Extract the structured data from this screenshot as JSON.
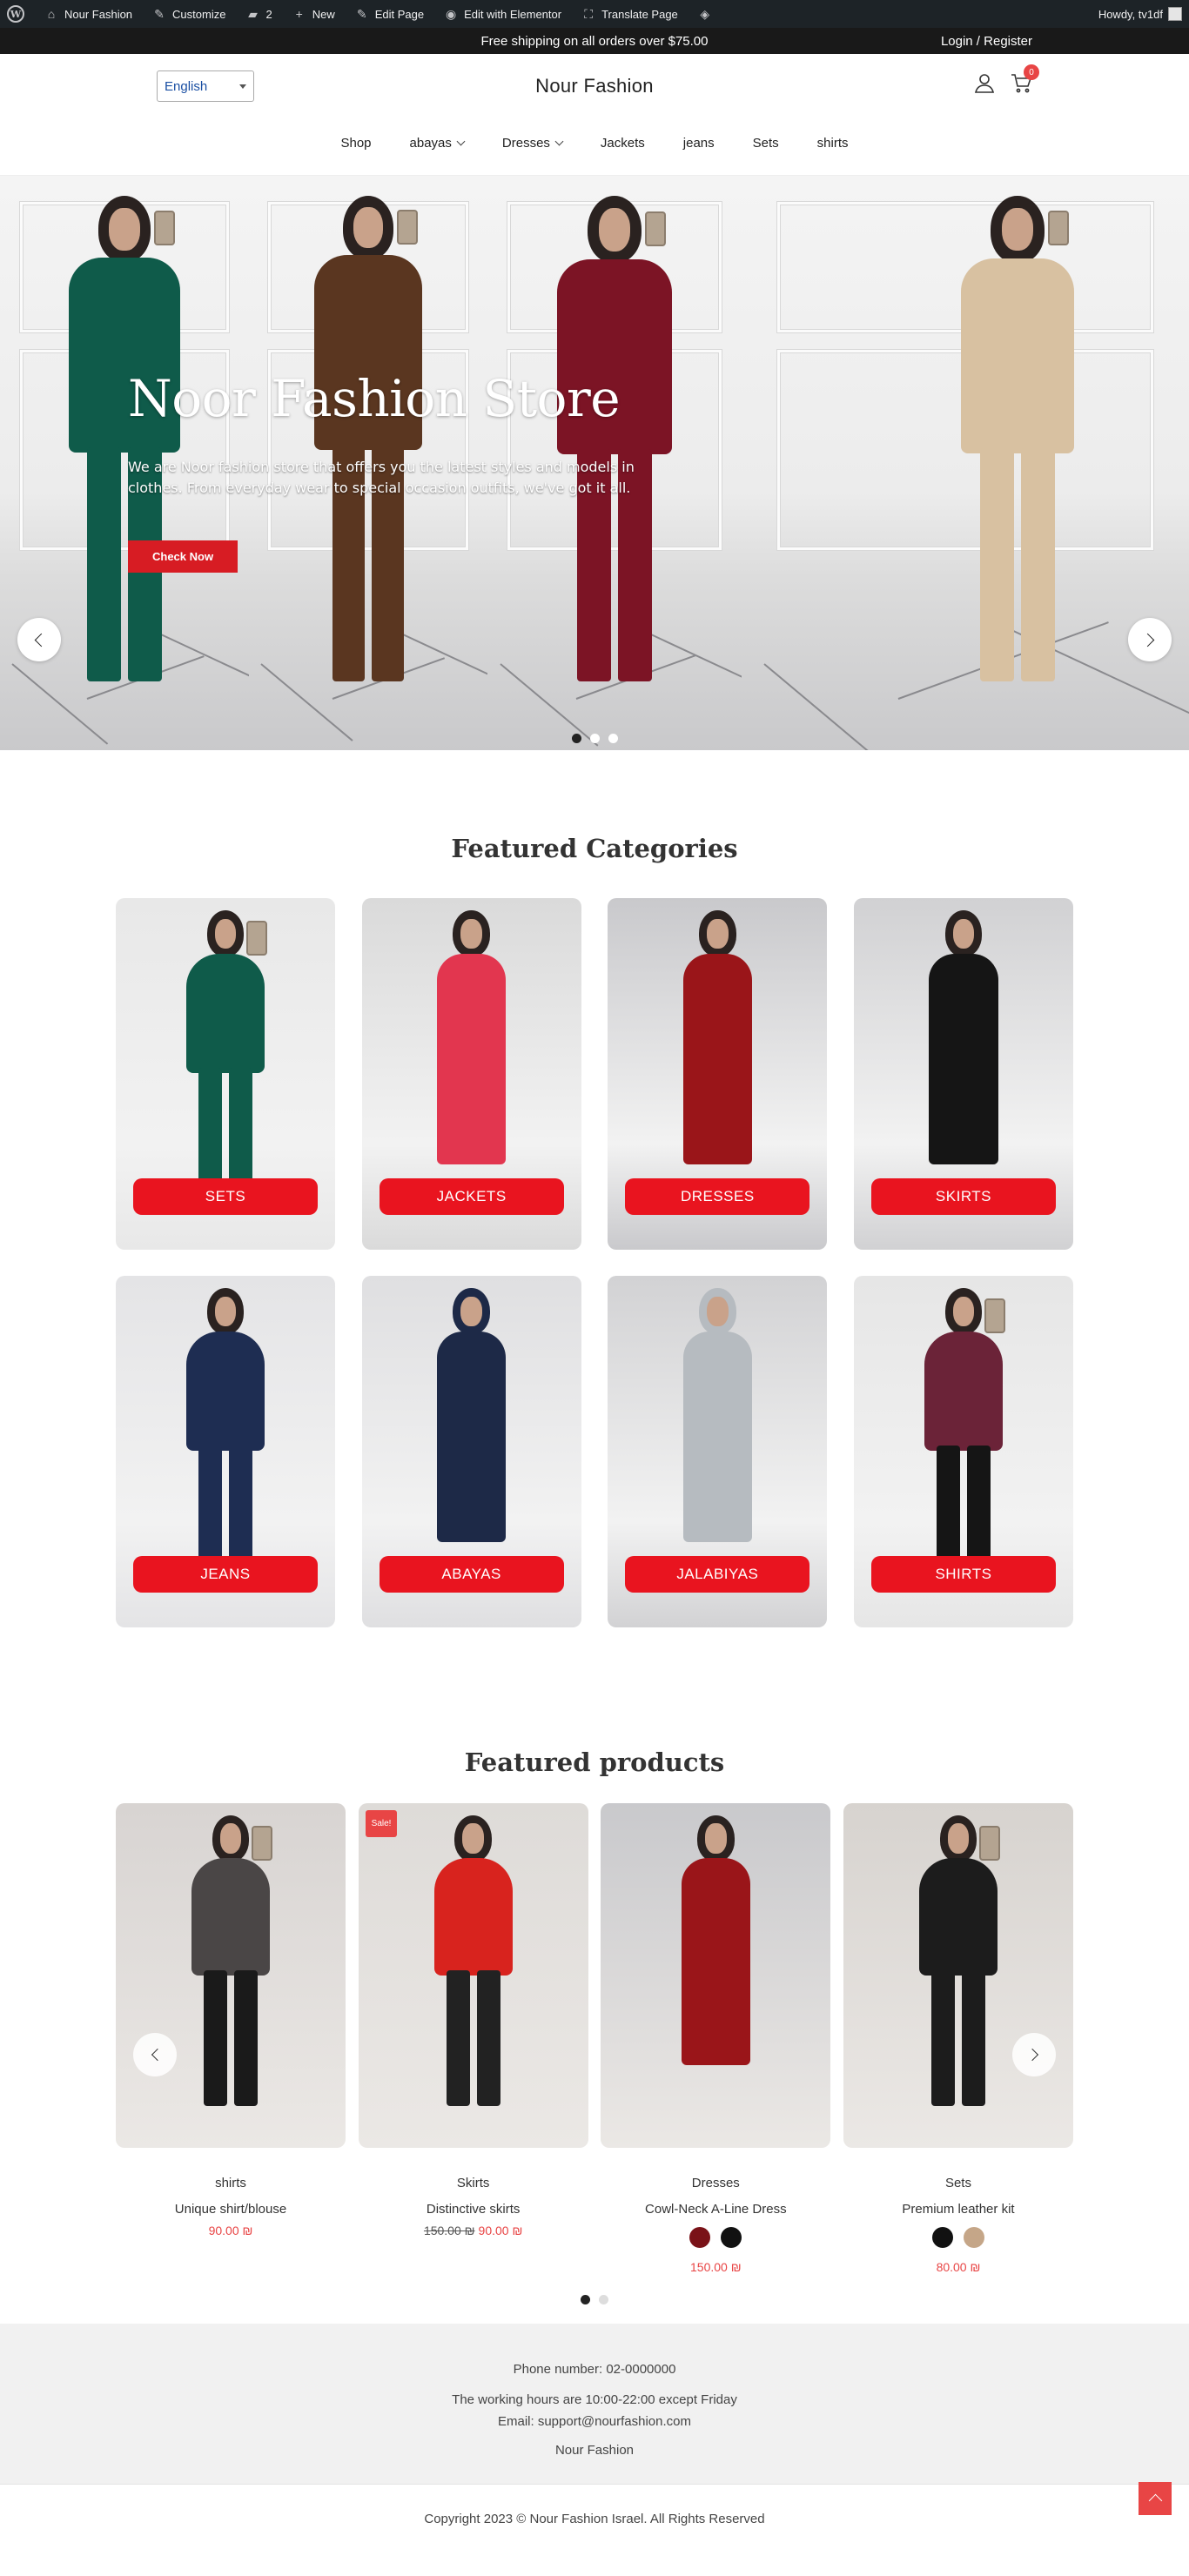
{
  "adminbar": {
    "site_name": "Nour Fashion",
    "customize": "Customize",
    "comments_count": "2",
    "new": "New",
    "edit_page": "Edit Page",
    "edit_elementor": "Edit with Elementor",
    "translate_page": "Translate Page",
    "howdy": "Howdy, tv1df"
  },
  "topbar": {
    "notice": "Free shipping on all orders over $75.00",
    "login": "Login / Register"
  },
  "header": {
    "language": "English",
    "brand": "Nour Fashion",
    "cart_count": "0",
    "nav": [
      {
        "label": "Shop",
        "dropdown": false
      },
      {
        "label": "abayas",
        "dropdown": true
      },
      {
        "label": "Dresses",
        "dropdown": true
      },
      {
        "label": "Jackets",
        "dropdown": false
      },
      {
        "label": "jeans",
        "dropdown": false
      },
      {
        "label": "Sets",
        "dropdown": false
      },
      {
        "label": "shirts",
        "dropdown": false
      }
    ]
  },
  "hero": {
    "title": "Noor Fashion Store",
    "subtitle": "We are Noor fashion store that offers you the latest styles and models in clothes. From everyday wear to special occasion outfits, we've got it all.",
    "button": "Check Now",
    "slides_count": 3,
    "active_slide": 1
  },
  "categories": {
    "title": "Featured Categories",
    "items": [
      {
        "label": "SETS",
        "outfit": "#0f5b4a",
        "bg": "#e8e8e8"
      },
      {
        "label": "JACKETS",
        "outfit": "#e2364f",
        "bg": "#dadada"
      },
      {
        "label": "DRESSES",
        "outfit": "#9a1519",
        "bg": "#c9c9cc"
      },
      {
        "label": "SKIRTS",
        "outfit": "#151515",
        "bg": "#d1d1d3"
      },
      {
        "label": "JEANS",
        "outfit": "#1e2d52",
        "bg": "#e4e4e6"
      },
      {
        "label": "ABAYAS",
        "outfit": "#1d2947",
        "bg": "#dfdfe1"
      },
      {
        "label": "JALABIYAS",
        "outfit": "#b6bbc0",
        "bg": "#d2d2d4"
      },
      {
        "label": "SHIRTS",
        "outfit": "#6b2338",
        "bg": "#e6e6e6"
      }
    ]
  },
  "products": {
    "title": "Featured products",
    "items": [
      {
        "category": "shirts",
        "name": "Unique shirt/blouse",
        "price": "90.00 ₪",
        "old_price": "",
        "sale": false,
        "outfit": "#4a4646",
        "bg": "#d8d4d2",
        "swatches": []
      },
      {
        "category": "Skirts",
        "name": "Distinctive skirts",
        "price": "90.00 ₪",
        "old_price": "150.00 ₪",
        "sale": true,
        "sale_label": "Sale!",
        "outfit": "#d8231e",
        "bg": "#dedbd8",
        "swatches": []
      },
      {
        "category": "Dresses",
        "name": "Cowl-Neck A-Line Dress",
        "price": "150.00 ₪",
        "old_price": "",
        "sale": false,
        "outfit": "#9a1519",
        "bg": "#c9c9cc",
        "swatches": [
          "#7a1218",
          "#111111"
        ]
      },
      {
        "category": "Sets",
        "name": "Premium leather kit",
        "price": "80.00 ₪",
        "old_price": "",
        "sale": false,
        "outfit": "#1c1c1c",
        "bg": "#d7d3cf",
        "swatches": [
          "#111111",
          "#c5a688"
        ]
      }
    ],
    "dots": 2,
    "active_dot": 0
  },
  "footer": {
    "phone": "Phone number: 02-0000000",
    "hours": "The working hours are 10:00-22:00 except Friday",
    "email": "Email: support@nourfashion.com",
    "brand": "Nour Fashion",
    "copyright": "Copyright 2023 © Nour Fashion Israel. All Rights Reserved"
  },
  "colors": {
    "accent": "#e9141f",
    "price": "#e84545",
    "hero_button": "#d71c23"
  }
}
